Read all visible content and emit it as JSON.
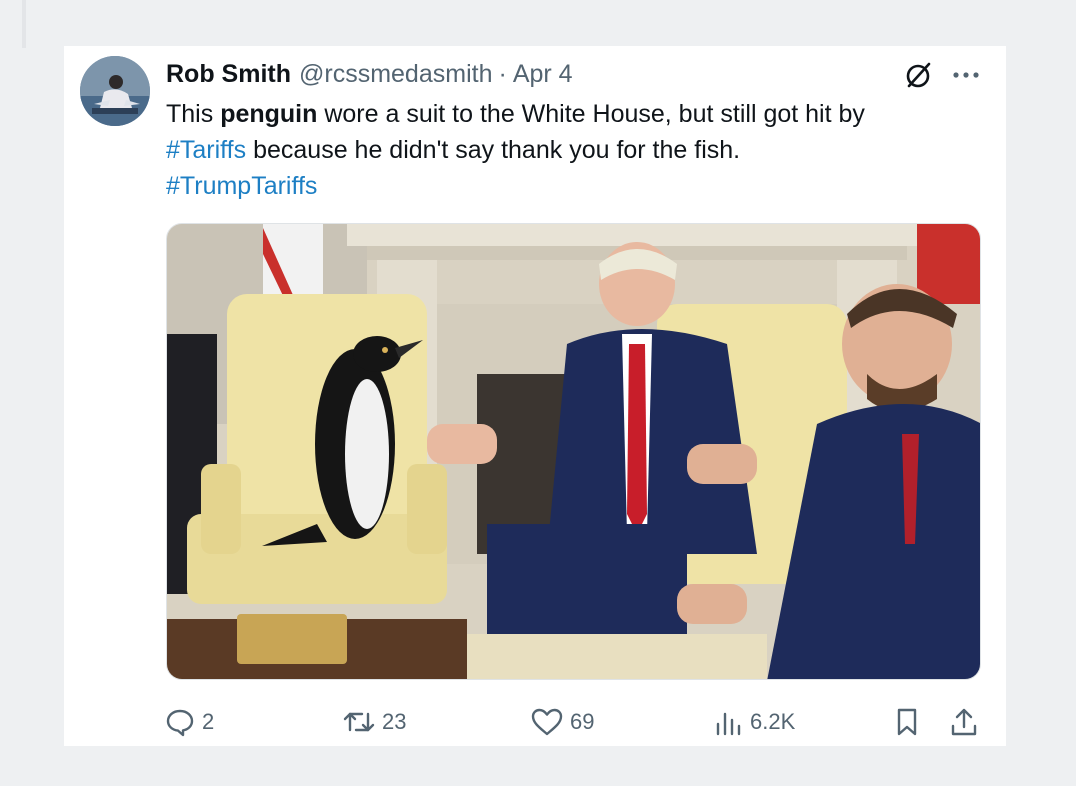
{
  "tweet": {
    "author": {
      "name": "Rob Smith",
      "handle": "@rcssmedasmith",
      "separator": "·",
      "date": "Apr 4"
    },
    "text": {
      "part1": "This ",
      "bold": "penguin",
      "part2": " wore a suit to the White House, but still got hit by",
      "hashtag1": "#Tariffs",
      "part3": " because he didn't say thank you for the fish.",
      "hashtag2": "#TrumpTariffs"
    },
    "icons": {
      "grok": "grok-icon",
      "more": "more-options-icon"
    },
    "actions": {
      "replies": "2",
      "reposts": "23",
      "likes": "69",
      "views": "6.2K"
    }
  },
  "colors": {
    "background": "#eef0f2",
    "card": "#ffffff",
    "text": "#0f1419",
    "muted": "#536471",
    "hashtag": "#1d7fc4"
  }
}
